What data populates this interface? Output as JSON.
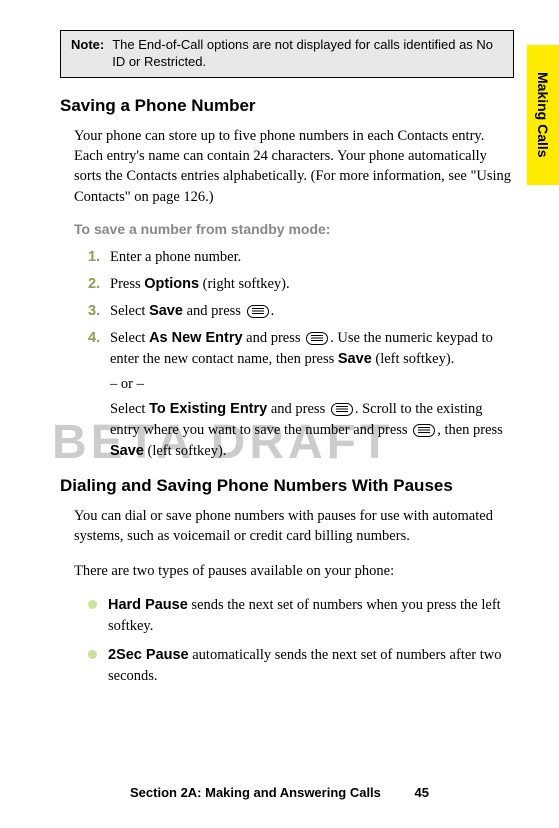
{
  "sideTab": "Making Calls",
  "note": {
    "label": "Note:",
    "text": "The End-of-Call options are not displayed for calls identified as No ID or Restricted."
  },
  "watermark": "BETA DRAFT",
  "section1": {
    "heading": "Saving a Phone Number",
    "intro": "Your phone can store up to five phone numbers in each Contacts entry. Each entry's name can contain 24 characters. Your phone automatically sorts the Contacts entries alphabetically. (For more information, see \"Using Contacts\" on page 126.)",
    "subhead": "To save a number from standby mode:",
    "steps": {
      "s1": "Enter a phone number.",
      "s2a": "Press ",
      "s2b": "Options",
      "s2c": " (right softkey).",
      "s3a": "Select ",
      "s3b": "Save",
      "s3c": " and press ",
      "s3d": ".",
      "s4a": "Select ",
      "s4b": "As New Entry",
      "s4c": " and press ",
      "s4d": ". Use the numeric keypad to enter the new contact name, then press ",
      "s4e": "Save",
      "s4f": " (left softkey).",
      "orSep": "– or –",
      "s4g": "Select ",
      "s4h": "To Existing Entry",
      "s4i": " and press ",
      "s4j": ". Scroll to the existing entry where you want to save the number and press ",
      "s4k": ", then press ",
      "s4l": "Save",
      "s4m": " (left softkey)."
    }
  },
  "section2": {
    "heading": "Dialing and Saving Phone Numbers With Pauses",
    "intro": "You can dial or save phone numbers with pauses for use with automated systems, such as voicemail or credit card billing numbers.",
    "lead": "There are two types of pauses available on your phone:",
    "bullets": {
      "b1a": "Hard Pause",
      "b1b": " sends the next set of numbers when you press the left softkey.",
      "b2a": "2Sec Pause",
      "b2b": " automatically sends the next set of numbers after two seconds."
    }
  },
  "footer": {
    "section": "Section 2A: Making and Answering Calls",
    "page": "45"
  }
}
